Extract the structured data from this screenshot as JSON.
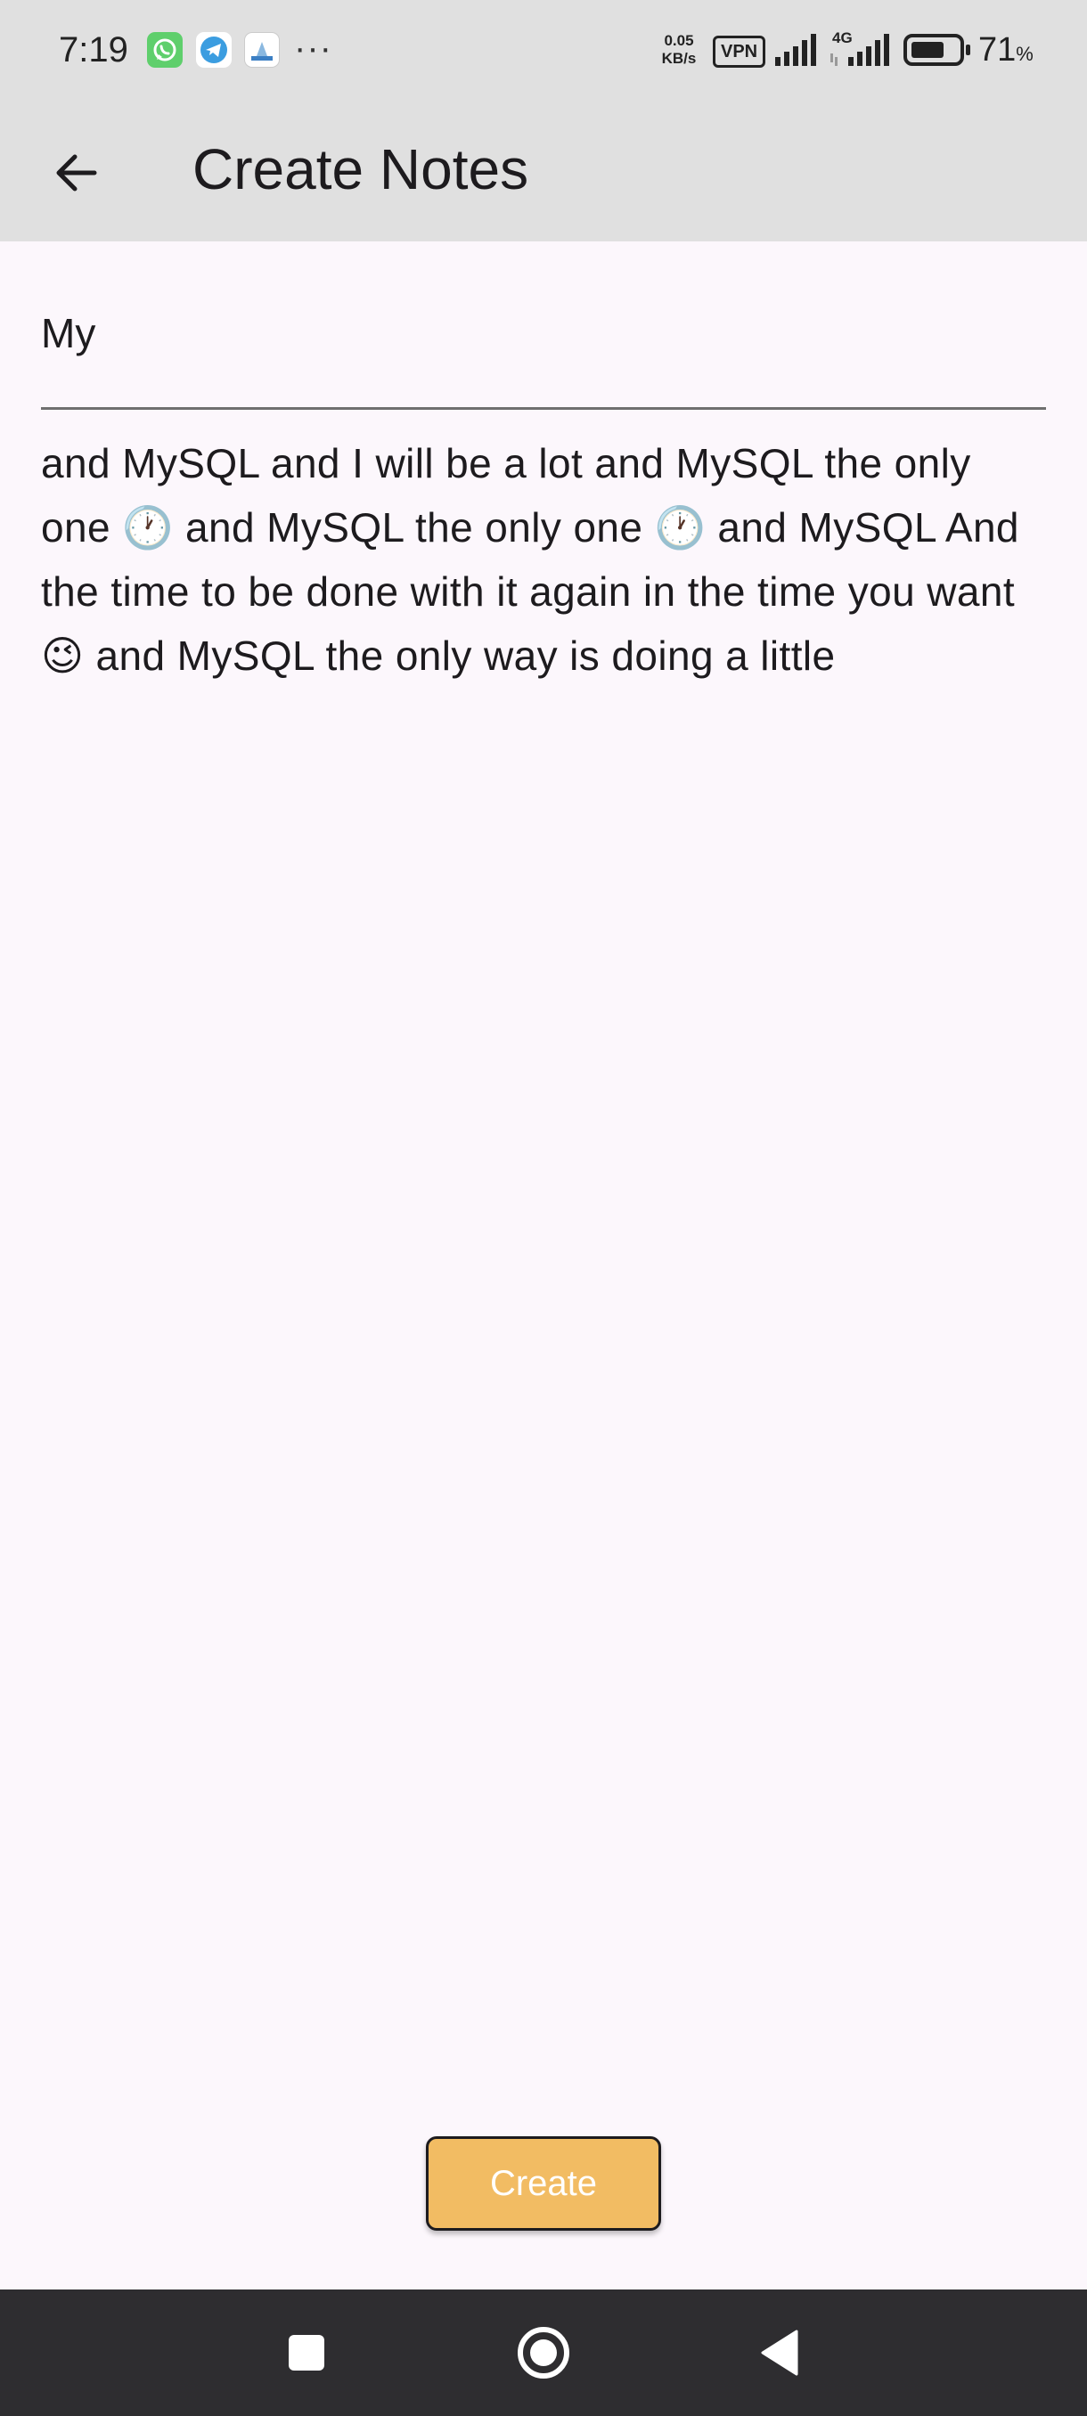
{
  "status_bar": {
    "time": "7:19",
    "more_notifications": "···",
    "net_speed_value": "0.05",
    "net_speed_unit": "KB/s",
    "vpn": "VPN",
    "network_type": "4G",
    "battery_value": "71",
    "battery_unit": "%",
    "battery_level": 0.71,
    "notification_icons": [
      "whatsapp-icon",
      "telegram-icon",
      "app-notification-icon"
    ]
  },
  "app_bar": {
    "title": "Create Notes",
    "back_icon": "arrow-left-icon"
  },
  "note": {
    "title_value": "My",
    "body_value": "and MySQL and I will be a lot and MySQL the only one 🕐 and MySQL the only one 🕐 and MySQL And the time to be done with it again in the time you want 😉 and MySQL the only way is doing a little"
  },
  "actions": {
    "create_label": "Create"
  },
  "nav_bar": {
    "icons": [
      "recents-square-icon",
      "home-circle-icon",
      "back-triangle-icon"
    ]
  },
  "colors": {
    "app_bar_bg": "#e0e0e0",
    "page_bg": "#fcf7fc",
    "button_bg": "#f2bc63",
    "nav_bar_bg": "#2e2d30"
  }
}
